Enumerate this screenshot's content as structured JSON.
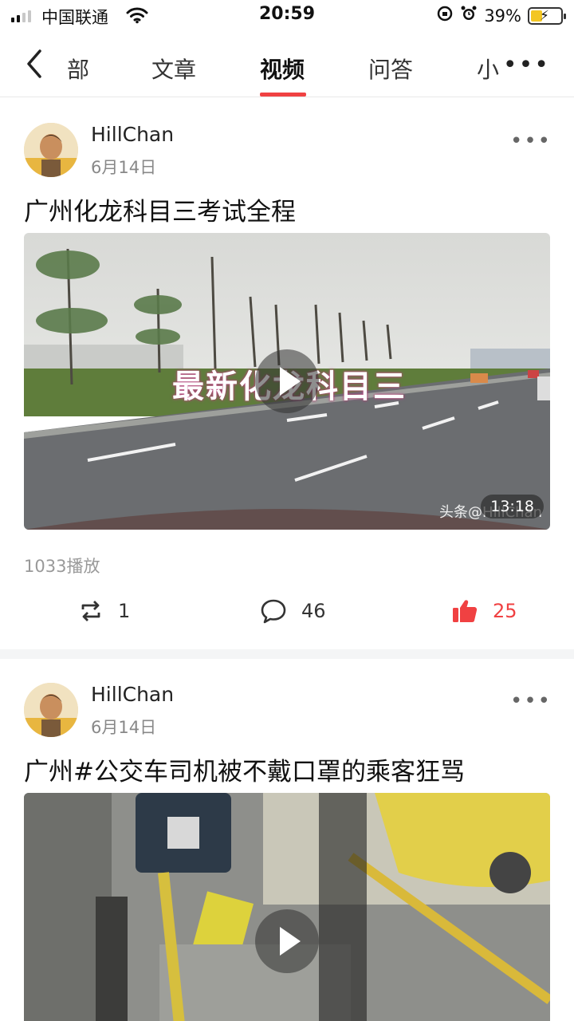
{
  "status_bar": {
    "carrier": "中国联通",
    "time": "20:59",
    "battery_percent": "39%",
    "battery_level": 0.39
  },
  "nav": {
    "tabs": [
      {
        "label": "部",
        "active": false
      },
      {
        "label": "文章",
        "active": false
      },
      {
        "label": "视频",
        "active": true
      },
      {
        "label": "问答",
        "active": false
      },
      {
        "label": "小",
        "active": false
      }
    ],
    "accent_color": "#f04142"
  },
  "posts": [
    {
      "author": "HillChan",
      "date": "6月14日",
      "title": "广州化龙科目三考试全程",
      "video_overlay_text": "最新化龙科目三",
      "duration": "13:18",
      "watermark": "头条@HillChan",
      "plays": "1033播放",
      "reposts": "1",
      "comments": "46",
      "likes": "25"
    },
    {
      "author": "HillChan",
      "date": "6月14日",
      "title": "广州#公交车司机被不戴口罩的乘客狂骂"
    }
  ]
}
